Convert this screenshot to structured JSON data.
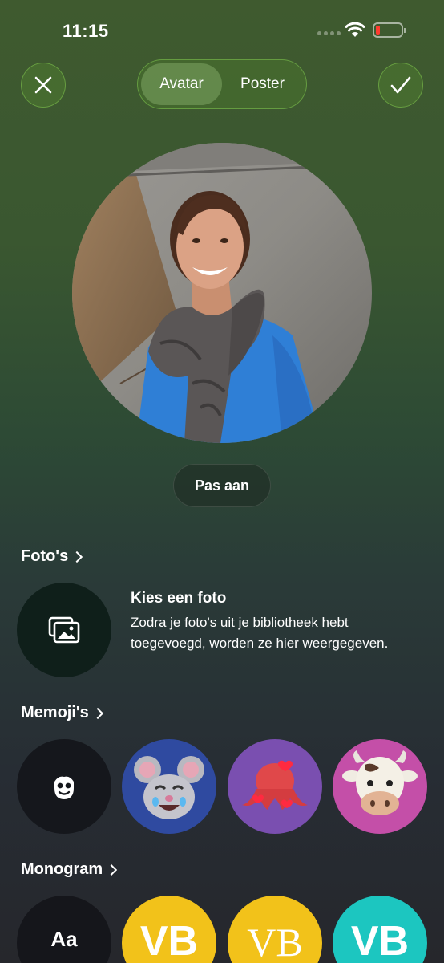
{
  "status_bar": {
    "time": "11:15",
    "battery_level_fraction": 0.18,
    "battery_color": "#ff3b30"
  },
  "header": {
    "close_icon": "close-icon",
    "done_icon": "checkmark-icon",
    "tabs": [
      {
        "label": "Avatar",
        "active": true
      },
      {
        "label": "Poster",
        "active": false
      }
    ]
  },
  "avatar": {
    "adjust_label": "Pas aan"
  },
  "photos_section": {
    "title": "Foto's",
    "choose_title": "Kies een foto",
    "choose_description": "Zodra je foto's uit je bibliotheek hebt toegevoegd, worden ze hier weergegeven."
  },
  "memoji_section": {
    "title": "Memoji's",
    "items": [
      {
        "name": "memoji-new",
        "color": "#15171c"
      },
      {
        "name": "mouse-memoji",
        "color": "#2f4aa0"
      },
      {
        "name": "octopus-memoji",
        "color": "#7a4fb0"
      },
      {
        "name": "cow-memoji",
        "color": "#c44fa8"
      }
    ]
  },
  "monogram_section": {
    "title": "Monogram",
    "items": [
      {
        "text": "Aa",
        "color": "#15161b"
      },
      {
        "text": "VB",
        "color": "#f2c21a"
      },
      {
        "text": "VB",
        "color": "#f2c21a"
      },
      {
        "text": "VB",
        "color": "#1cc6c0"
      }
    ]
  }
}
